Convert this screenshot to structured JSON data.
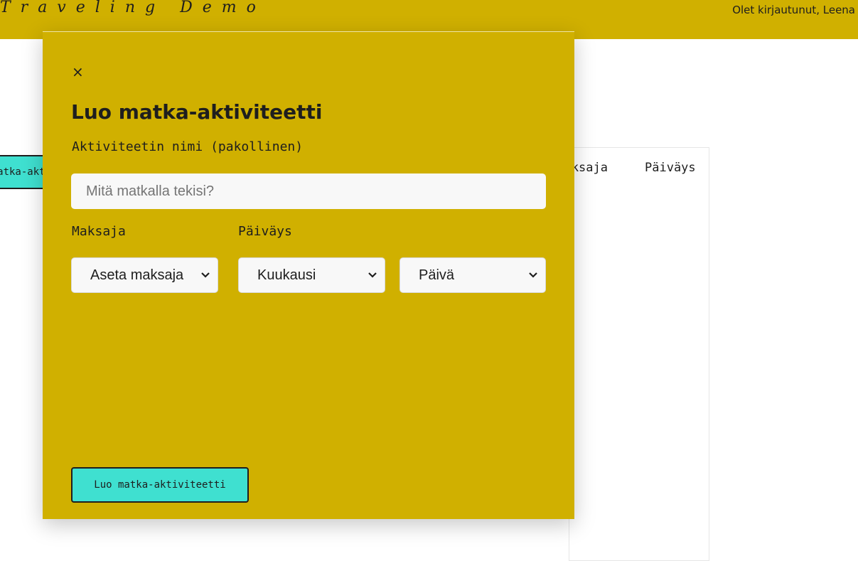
{
  "header": {
    "brand": "Traveling Demo",
    "user_status": "Olet kirjautunut, Leena"
  },
  "background": {
    "create_button_label": "Luo matka-aktiviteetti",
    "columns": [
      "Maksaja",
      "Päiväys"
    ]
  },
  "modal": {
    "close_label": "×",
    "title": "Luo matka-aktiviteetti",
    "name_label": "Aktiviteetin nimi (pakollinen)",
    "name_placeholder": "Mitä matkalla tekisi?",
    "name_value": "",
    "payer_label": "Maksaja",
    "date_label": "Päiväys",
    "payer_select": "Aseta maksaja",
    "month_select": "Kuukausi",
    "day_select": "Päivä",
    "submit_label": "Luo matka-aktiviteetti"
  },
  "colors": {
    "accent": "#d0b000",
    "button": "#3fe0d0",
    "text": "#1e1e1e"
  }
}
